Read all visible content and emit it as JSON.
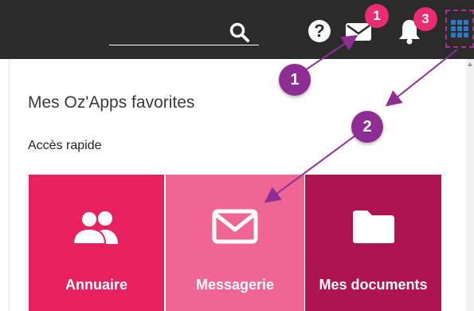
{
  "header": {
    "search_icon": "search-icon",
    "help_label": "?",
    "mail_icon": "mail-icon",
    "mail_badge": "1",
    "bell_icon": "bell-icon",
    "bell_badge": "3",
    "apps_icon": "apps-grid-icon"
  },
  "panel": {
    "title": "Mes Oz'Apps favorites",
    "quick_access_label": "Accès rapide",
    "tiles": [
      {
        "label": "Annuaire",
        "icon": "users-icon",
        "color": "#e7215e"
      },
      {
        "label": "Messagerie",
        "icon": "envelope-icon",
        "color": "#ef6593"
      },
      {
        "label": "Mes documents",
        "icon": "folder-icon",
        "color": "#ad1450"
      }
    ]
  },
  "annotations": {
    "callout_1": "1",
    "callout_2": "2",
    "callout_color": "#8e2e95"
  },
  "colors": {
    "topbar": "#2b2b2b",
    "badge": "#ec2c72",
    "apps_icon": "#2a79c4"
  }
}
